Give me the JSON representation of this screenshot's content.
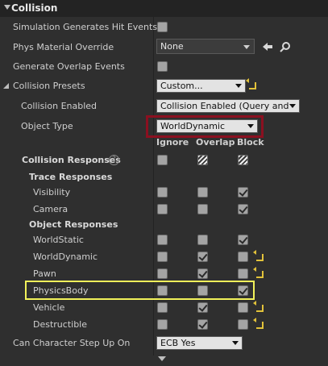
{
  "section_title": "Collision",
  "rows": {
    "sim_hit": "Simulation Generates Hit Events",
    "phys_mat": "Phys Material Override",
    "overlap": "Generate Overlap Events",
    "presets": "Collision Presets",
    "enabled": "Collision Enabled",
    "object_type": "Object Type",
    "responses": "Collision Responses",
    "trace": "Trace Responses",
    "visibility": "Visibility",
    "camera": "Camera",
    "object_resp": "Object Responses",
    "world_static": "WorldStatic",
    "world_dynamic": "WorldDynamic",
    "pawn": "Pawn",
    "physics_body": "PhysicsBody",
    "vehicle": "Vehicle",
    "destructible": "Destructible",
    "step_up": "Can Character Step Up On"
  },
  "values": {
    "phys_mat": "None",
    "presets": "Custom...",
    "enabled": "Collision Enabled (Query and Pl",
    "object_type": "WorldDynamic",
    "step_up": "ECB Yes"
  },
  "columns": {
    "ignore": "Ignore",
    "overlap": "Overlap",
    "block": "Block"
  },
  "help_glyph": "?",
  "highlight_colors": {
    "object_type_box": "#8b1020",
    "physics_body_box": "#f1f15a",
    "reset_arrow": "#e2c23a"
  }
}
